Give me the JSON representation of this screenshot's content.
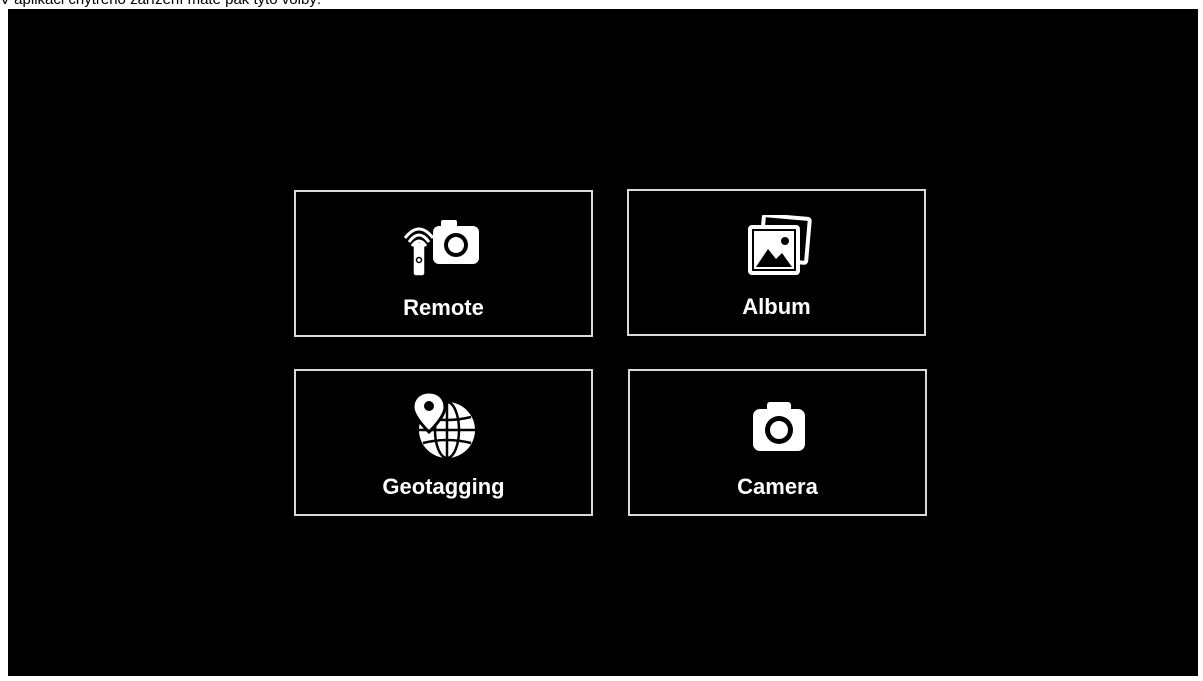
{
  "caption": "V aplikaci chytrého zařízení máte pak tyto volby:",
  "menu": {
    "items": [
      {
        "label": "Remote",
        "icon": "remote-camera-icon"
      },
      {
        "label": "Album",
        "icon": "album-icon"
      },
      {
        "label": "Geotagging",
        "icon": "geotagging-icon"
      },
      {
        "label": "Camera",
        "icon": "camera-icon"
      }
    ]
  },
  "colors": {
    "background": "#000000",
    "tile_border": "#d9d9d9",
    "text": "#ffffff"
  }
}
